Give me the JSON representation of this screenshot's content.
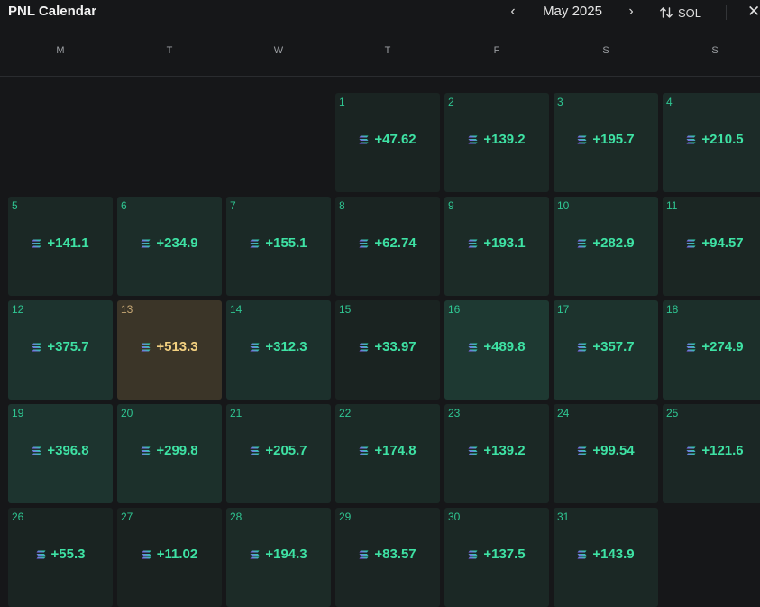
{
  "header": {
    "title": "PNL Calendar",
    "prev_label": "‹",
    "month": "May 2025",
    "next_label": "›",
    "currency": "SOL",
    "close_label": "✕"
  },
  "weekdays": [
    "M",
    "T",
    "W",
    "T",
    "F",
    "S",
    "S"
  ],
  "calendar": {
    "leading_empty_days": 3,
    "days": [
      {
        "day": "1",
        "pnl": "+47.62",
        "level": 0.1
      },
      {
        "day": "2",
        "pnl": "+139.2",
        "level": 0.27
      },
      {
        "day": "3",
        "pnl": "+195.7",
        "level": 0.38
      },
      {
        "day": "4",
        "pnl": "+210.5",
        "level": 0.41
      },
      {
        "day": "5",
        "pnl": "+141.1",
        "level": 0.28
      },
      {
        "day": "6",
        "pnl": "+234.9",
        "level": 0.46
      },
      {
        "day": "7",
        "pnl": "+155.1",
        "level": 0.3
      },
      {
        "day": "8",
        "pnl": "+62.74",
        "level": 0.12
      },
      {
        "day": "9",
        "pnl": "+193.1",
        "level": 0.38
      },
      {
        "day": "10",
        "pnl": "+282.9",
        "level": 0.55
      },
      {
        "day": "11",
        "pnl": "+94.57",
        "level": 0.18
      },
      {
        "day": "12",
        "pnl": "+375.7",
        "level": 0.73
      },
      {
        "day": "13",
        "pnl": "+513.3",
        "level": 1.0,
        "highlight": true
      },
      {
        "day": "14",
        "pnl": "+312.3",
        "level": 0.61
      },
      {
        "day": "15",
        "pnl": "+33.97",
        "level": 0.07
      },
      {
        "day": "16",
        "pnl": "+489.8",
        "level": 0.95
      },
      {
        "day": "17",
        "pnl": "+357.7",
        "level": 0.7
      },
      {
        "day": "18",
        "pnl": "+274.9",
        "level": 0.54
      },
      {
        "day": "19",
        "pnl": "+396.8",
        "level": 0.77
      },
      {
        "day": "20",
        "pnl": "+299.8",
        "level": 0.58
      },
      {
        "day": "21",
        "pnl": "+205.7",
        "level": 0.4
      },
      {
        "day": "22",
        "pnl": "+174.8",
        "level": 0.34
      },
      {
        "day": "23",
        "pnl": "+139.2",
        "level": 0.27
      },
      {
        "day": "24",
        "pnl": "+99.54",
        "level": 0.19
      },
      {
        "day": "25",
        "pnl": "+121.6",
        "level": 0.24
      },
      {
        "day": "26",
        "pnl": "+55.3",
        "level": 0.11
      },
      {
        "day": "27",
        "pnl": "+11.02",
        "level": 0.02
      },
      {
        "day": "28",
        "pnl": "+194.3",
        "level": 0.38
      },
      {
        "day": "29",
        "pnl": "+83.57",
        "level": 0.16
      },
      {
        "day": "30",
        "pnl": "+137.5",
        "level": 0.27
      },
      {
        "day": "31",
        "pnl": "+143.9",
        "level": 0.28
      }
    ]
  },
  "colors": {
    "positive_text": "#3ee2a4",
    "day_number": "#2fc692",
    "best_day_bg": "#3b3528",
    "best_day_text": "#f2d080",
    "cell_bg_low": "#1a2120",
    "cell_bg_high": "#1e3a33"
  }
}
